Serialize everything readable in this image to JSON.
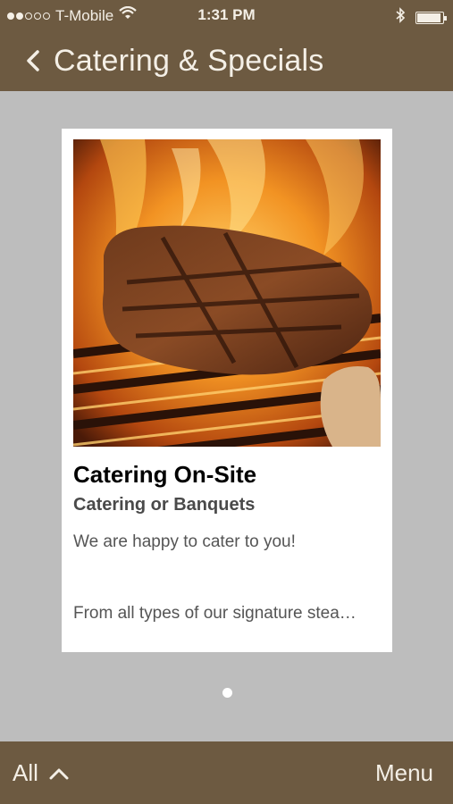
{
  "status_bar": {
    "carrier": "T-Mobile",
    "time": "1:31 PM",
    "signal_bars_filled": 2,
    "signal_bars_total": 5,
    "battery_level": 0.9
  },
  "nav": {
    "title": "Catering & Specials",
    "back_icon": "chevron-left-icon"
  },
  "card": {
    "image_desc": "grilled-steak-image",
    "title": "Catering On-Site",
    "subtitle": "Catering or Banquets",
    "description": "We are happy to cater to you!",
    "description2": "From all types of our signature stea…"
  },
  "pager": {
    "current": 1,
    "total": 1
  },
  "bottom_bar": {
    "filter_label": "All",
    "filter_icon": "chevron-up-icon",
    "menu_label": "Menu"
  },
  "colors": {
    "bar": "#6d5a41",
    "background": "#bdbdbd",
    "text_light": "#f4efe6"
  }
}
